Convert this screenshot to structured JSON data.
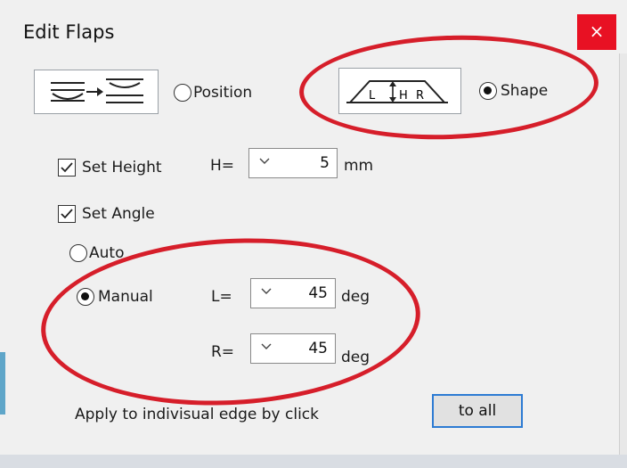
{
  "window": {
    "title": "Edit Flaps",
    "close_glyph": "×"
  },
  "mode": {
    "position_label": "Position",
    "shape_label": "Shape",
    "selected": "shape",
    "shape_icon_letters": {
      "left": "L",
      "middle": "H",
      "right": "R"
    }
  },
  "height": {
    "checkbox_label": "Set Height",
    "checked": true,
    "prefix": "H=",
    "value": "5",
    "unit": "mm"
  },
  "angle": {
    "checkbox_label": "Set Angle",
    "checked": true,
    "auto_label": "Auto",
    "manual_label": "Manual",
    "selected": "manual",
    "left": {
      "prefix": "L=",
      "value": "45",
      "unit": "deg"
    },
    "right": {
      "prefix": "R=",
      "value": "45",
      "unit": "deg"
    }
  },
  "footer": {
    "hint": "Apply to indivisual edge by click",
    "button_label": "to all"
  },
  "colors": {
    "accent": "#2d7bd3",
    "annotation": "#d61e2a",
    "close": "#e81123"
  }
}
